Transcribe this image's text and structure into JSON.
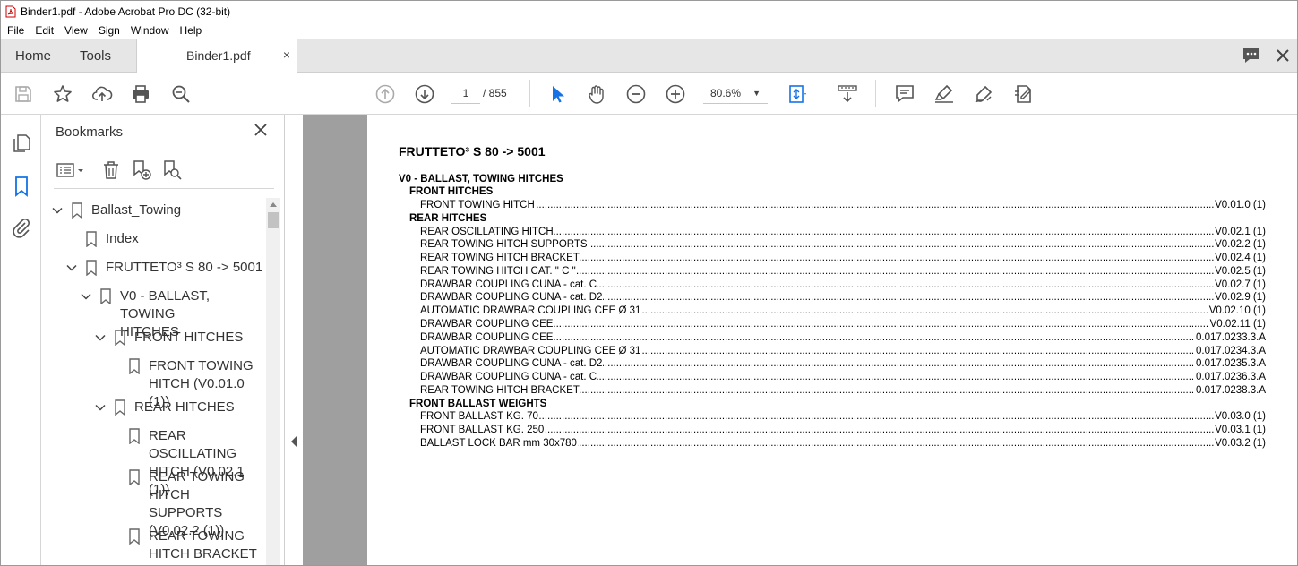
{
  "window": {
    "title": "Binder1.pdf - Adobe Acrobat Pro DC (32-bit)"
  },
  "menu": [
    "File",
    "Edit",
    "View",
    "Sign",
    "Window",
    "Help"
  ],
  "tabs": {
    "home": "Home",
    "tools": "Tools",
    "document": "Binder1.pdf",
    "close": "×"
  },
  "toolbar": {
    "page_current": "1",
    "page_total": "/ 855",
    "zoom": "80.6%"
  },
  "bookmarks": {
    "header": "Bookmarks",
    "close": "✕",
    "items": [
      {
        "label": "Ballast_Towing"
      },
      {
        "label": "Index"
      },
      {
        "label": "FRUTTETO³ S 80 -> 5001"
      },
      {
        "label": "V0 - BALLAST, TOWING\nHITCHES"
      },
      {
        "label": "FRONT HITCHES"
      },
      {
        "label": "FRONT TOWING\nHITCH (V0.01.0 (1))"
      },
      {
        "label": "REAR HITCHES"
      },
      {
        "label": "REAR OSCILLATING\nHITCH (V0.02.1 (1))"
      },
      {
        "label": "REAR TOWING\nHITCH SUPPORTS\n(V0.02.2 (1))"
      },
      {
        "label": "REAR TOWING\nHITCH BRACKET"
      }
    ]
  },
  "document": {
    "title": "FRUTTETO³ S 80 -> 5001",
    "lines": [
      {
        "text": "V0 - BALLAST, TOWING HITCHES",
        "ref": ""
      },
      {
        "text": "FRONT HITCHES",
        "ref": ""
      },
      {
        "text": "FRONT TOWING HITCH",
        "ref": "V0.01.0 (1)"
      },
      {
        "text": "REAR HITCHES",
        "ref": ""
      },
      {
        "text": "REAR OSCILLATING HITCH",
        "ref": "V0.02.1 (1)"
      },
      {
        "text": "REAR TOWING HITCH SUPPORTS",
        "ref": "V0.02.2 (1)"
      },
      {
        "text": "REAR TOWING HITCH BRACKET",
        "ref": "V0.02.4 (1)"
      },
      {
        "text": "REAR TOWING HITCH CAT. \" C \"",
        "ref": "V0.02.5 (1)"
      },
      {
        "text": "DRAWBAR COUPLING CUNA - cat. C",
        "ref": "V0.02.7 (1)"
      },
      {
        "text": "DRAWBAR COUPLING CUNA - cat. D2",
        "ref": "V0.02.9 (1)"
      },
      {
        "text": "AUTOMATIC DRAWBAR COUPLING CEE Ø 31",
        "ref": "V0.02.10 (1)"
      },
      {
        "text": "DRAWBAR COUPLING CEE",
        "ref": "V0.02.11 (1)"
      },
      {
        "text": "DRAWBAR COUPLING CEE",
        "ref": "0.017.0233.3.A"
      },
      {
        "text": "AUTOMATIC DRAWBAR COUPLING CEE Ø 31",
        "ref": "0.017.0234.3.A"
      },
      {
        "text": "DRAWBAR COUPLING CUNA - cat. D2",
        "ref": "0.017.0235.3.A"
      },
      {
        "text": "DRAWBAR COUPLING CUNA - cat. C",
        "ref": "0.017.0236.3.A"
      },
      {
        "text": "REAR TOWING HITCH BRACKET",
        "ref": "0.017.0238.3.A"
      },
      {
        "text": "FRONT BALLAST WEIGHTS",
        "ref": ""
      },
      {
        "text": "FRONT BALLAST KG. 70",
        "ref": "V0.03.0 (1)"
      },
      {
        "text": "FRONT BALLAST KG. 250",
        "ref": "V0.03.1 (1)"
      },
      {
        "text": "BALLAST LOCK BAR mm 30x780",
        "ref": "V0.03.2 (1)"
      }
    ]
  }
}
